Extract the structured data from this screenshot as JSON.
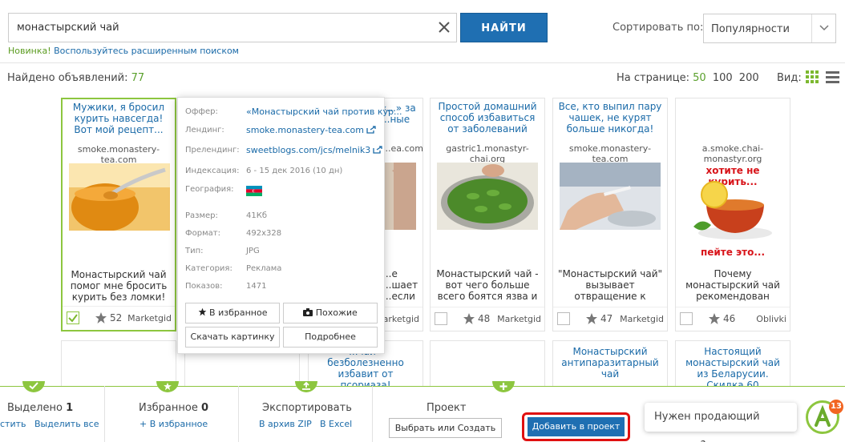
{
  "search": {
    "query": "монастырский чай",
    "button": "НАЙТИ",
    "hint_new": "Новинка!",
    "hint_link": "Воспользуйтесь расширенным поиском"
  },
  "sort": {
    "label": "Сортировать по:",
    "value": "Популярности"
  },
  "results": {
    "found_label": "Найдено объявлений:",
    "found_count": "77",
    "per_page_label": "На странице:",
    "per_page_options": [
      "50",
      "100",
      "200"
    ],
    "view_label": "Вид:"
  },
  "cards": [
    {
      "title": "Мужики, я бросил курить навсегда! Вот мой рецепт...",
      "domain": "smoke.monastery-tea.com",
      "image": "honey-jar",
      "desc": "Монастырский чай помог мне бросить курить без ломки!",
      "rating": "52",
      "network": "Marketgid"
    },
    {
      "title": "",
      "domain": "",
      "image": "",
      "desc": "",
      "rating": "",
      "network": ""
    },
    {
      "title": "«...» за ...ные",
      "domain": "...ea.com",
      "image": "partial-hands",
      "desc": "...е ...шает ...если ...ом?",
      "rating": "",
      "network": "...arketgid"
    },
    {
      "title": "Простой домашний способ избавиться от заболеваний желудка",
      "domain": "gastric1.monastyr-chai.org",
      "image": "green-pods-bowl",
      "desc": "Монастырский чай - вот чего больше всего боятся язва и гастрит",
      "rating": "48",
      "network": "Marketgid"
    },
    {
      "title": "Все, кто выпил пару чашек, не курят больше никогда!",
      "domain": "smoke.monastery-tea.com",
      "image": "hand-cigarette",
      "desc": "\"Монастырский чай\" вызывает отвращение к сигаретам!",
      "rating": "47",
      "network": "Marketgid"
    },
    {
      "title": "",
      "domain": "a.smoke.chai-monastyr.org",
      "image": "tea-cup",
      "img_text_top": "хотите не курить...",
      "img_text_bottom": "пейте это...",
      "desc": "Почему монастырский чай рекомендован каждому желающему бросить курить?",
      "rating": "46",
      "network": "Oblivki"
    }
  ],
  "cards_row2": [
    {
      "title": ""
    },
    {
      "title": ""
    },
    {
      "title": "...чай - безболезненно избавит от псориаза!"
    },
    {
      "title": ""
    },
    {
      "title": "Монастырский антипаразитарный чай"
    },
    {
      "title": "Настоящий монастырский чай из Беларусии. Скидка 60"
    }
  ],
  "popup": {
    "offer_label": "Оффер:",
    "offer_value": "«Монастырский чай против кур...",
    "landing_label": "Лендинг:",
    "landing_value": "smoke.monastery-tea.com",
    "prelanding_label": "Прелендинг:",
    "prelanding_value": "sweetblogs.com/jcs/melnik3",
    "index_label": "Индексация:",
    "index_value": "6 - 15 дек 2016 (10 дн)",
    "geo_label": "География:",
    "size_label": "Размер:",
    "size_value": "41Кб",
    "format_label": "Формат:",
    "format_value": "492x328",
    "type_label": "Тип:",
    "type_value": "JPG",
    "category_label": "Категория:",
    "category_value": "Реклама",
    "views_label": "Показов:",
    "views_value": "1471",
    "btn_favorite": "В избранное",
    "btn_similar": "Похожие",
    "btn_download": "Скачать картинку",
    "btn_more": "Подробнее"
  },
  "bottom": {
    "selected_label": "Выделено",
    "selected_count": "1",
    "selected_clear": "стить",
    "selected_all": "Выделить все",
    "fav_label": "Избранное",
    "fav_count": "0",
    "fav_add": "+ В избранное",
    "export_label": "Экспортировать",
    "export_zip": "В архив ZIP",
    "export_excel": "В Excel",
    "project_label": "Проект",
    "project_pick": "Выбрать или Создать",
    "project_add": "Добавить в проект",
    "chat_text": "Нужен продающий лендинг?",
    "badge_count": "13"
  }
}
